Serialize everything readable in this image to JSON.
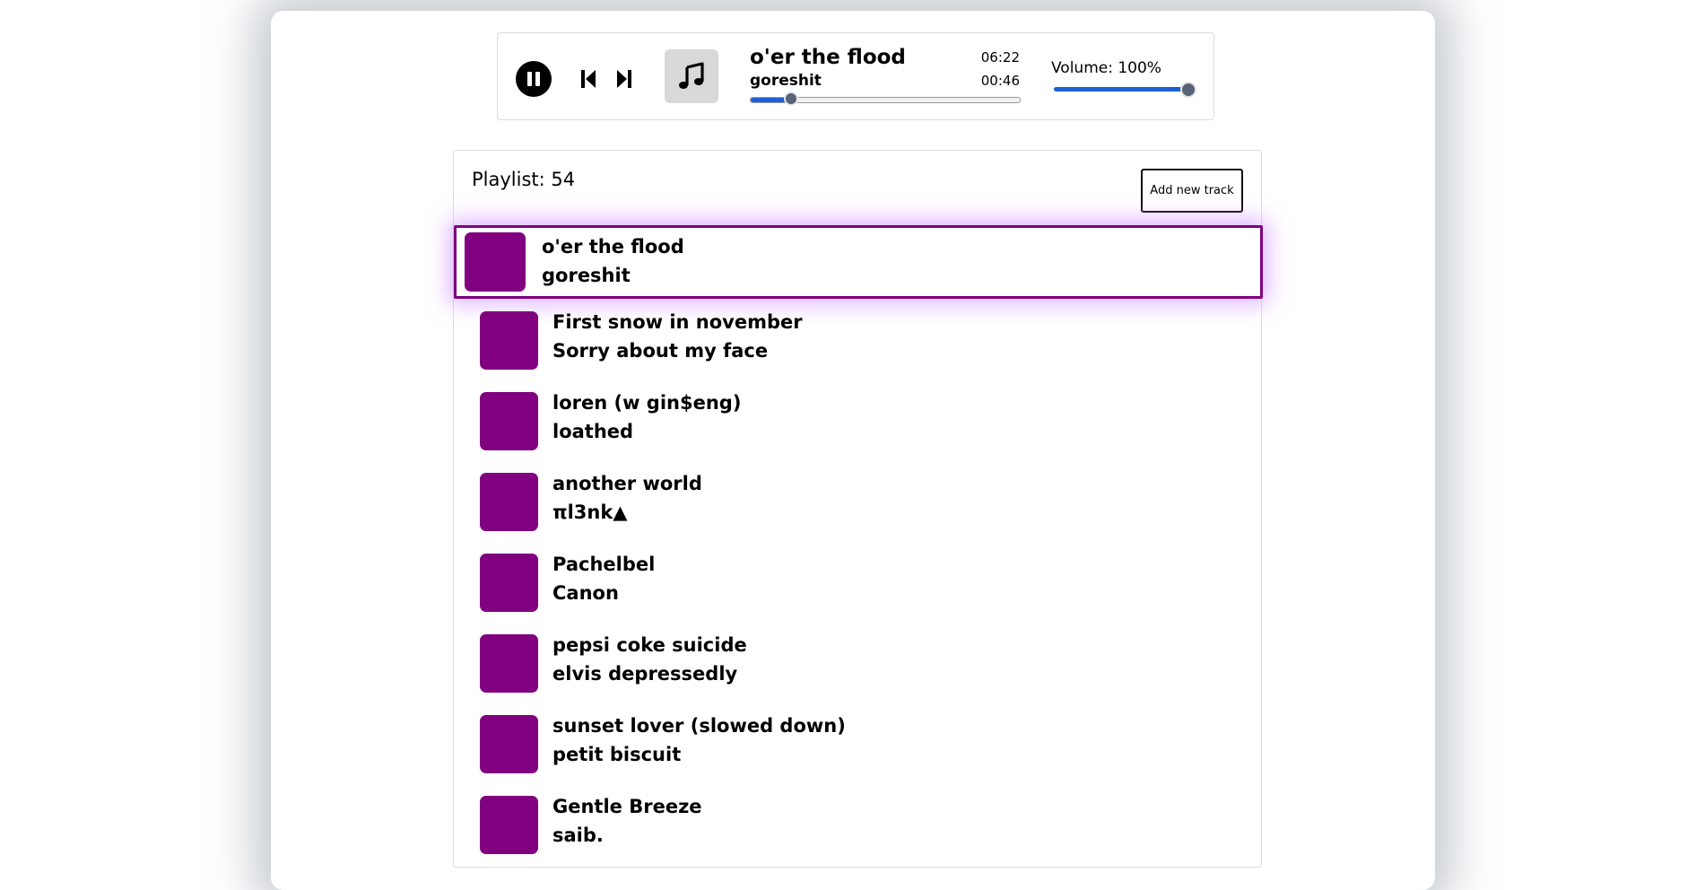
{
  "player": {
    "title": "o'er the flood",
    "artist": "goreshit",
    "duration": "06:22",
    "current_time": "00:46",
    "progress_fraction": 0.15,
    "volume_label": "Volume: 100%",
    "volume_fraction": 1.0,
    "is_playing": true,
    "icons": {
      "play_pause": "pause-icon",
      "prev": "skip-previous-icon",
      "next": "skip-next-icon",
      "cover": "music-note-icon"
    }
  },
  "playlist": {
    "heading": "Playlist: 54",
    "add_button_label": "Add new track",
    "active_index": 0,
    "tracks": [
      {
        "title": "o'er the flood",
        "artist": "goreshit"
      },
      {
        "title": "First snow in november",
        "artist": "Sorry about my face"
      },
      {
        "title": "loren (w gin$eng)",
        "artist": "loathed"
      },
      {
        "title": "another world",
        "artist": "πl3nk▲"
      },
      {
        "title": "Pachelbel",
        "artist": "Canon"
      },
      {
        "title": "pepsi coke suicide",
        "artist": "elvis depressedly"
      },
      {
        "title": "sunset lover (slowed down)",
        "artist": "petit biscuit"
      },
      {
        "title": "Gentle Breeze",
        "artist": "saib."
      }
    ]
  },
  "colors": {
    "accent_purple": "#800080",
    "active_border": "#7d0080",
    "slider_blue": "#1d5fd6",
    "knob_gray": "#5a6275"
  }
}
